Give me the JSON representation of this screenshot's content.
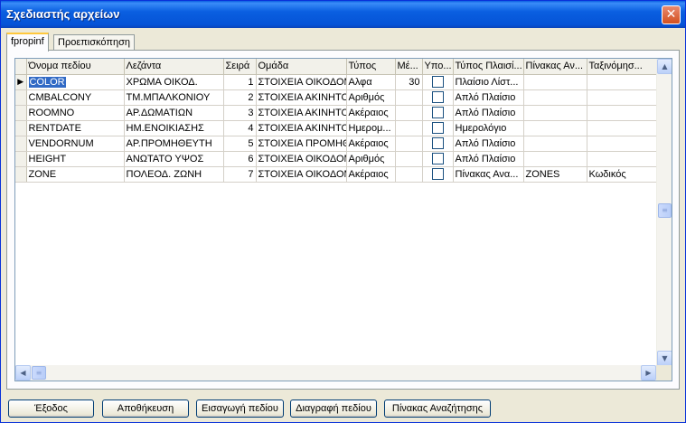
{
  "window": {
    "title": "Σχεδιαστής αρχείων",
    "close_glyph": "✕"
  },
  "tabs": [
    {
      "label": "fpropinf",
      "active": true
    },
    {
      "label": "Προεπισκόπηση",
      "active": false
    }
  ],
  "grid": {
    "columns": [
      "Όνομα πεδίου",
      "Λεζάντα",
      "Σειρά",
      "Ομάδα",
      "Τύπος",
      "Μέ...",
      "Υπο...",
      "Τύπος Πλαισί...",
      "Πίνακας Αν...",
      "Ταξινόμησ..."
    ],
    "rows": [
      {
        "field": "COLOR",
        "caption": "ΧΡΩΜΑ ΟΙΚΟΔ.",
        "order": "1",
        "group": "ΣΤΟΙΧΕΙΑ ΟΙΚΟΔΟΜ.",
        "type": "Αλφα",
        "size": "30",
        "required": false,
        "frame": "Πλαίσιο Λίστ...",
        "lookup": "",
        "sort": "",
        "selected": true
      },
      {
        "field": "CMBALCONY",
        "caption": "ΤΜ.ΜΠΑΛΚΟΝΙΟΥ",
        "order": "2",
        "group": "ΣΤΟΙΧΕΙΑ ΑΚΙΝΗΤΟΥ",
        "type": "Αριθμός",
        "size": "",
        "required": false,
        "frame": "Απλό Πλαίσιο",
        "lookup": "",
        "sort": "",
        "selected": false
      },
      {
        "field": "ROOMNO",
        "caption": "ΑΡ.ΔΩΜΑΤΙΩΝ",
        "order": "3",
        "group": "ΣΤΟΙΧΕΙΑ ΑΚΙΝΗΤΟΥ",
        "type": "Ακέραιος",
        "size": "",
        "required": false,
        "frame": "Απλό Πλαίσιο",
        "lookup": "",
        "sort": "",
        "selected": false
      },
      {
        "field": "RENTDATE",
        "caption": "ΗΜ.ΕΝΟΙΚΙΑΣΗΣ",
        "order": "4",
        "group": "ΣΤΟΙΧΕΙΑ ΑΚΙΝΗΤΟΥ",
        "type": "Ημερομ...",
        "size": "",
        "required": false,
        "frame": "Ημερολόγιο",
        "lookup": "",
        "sort": "",
        "selected": false
      },
      {
        "field": "VENDORNUM",
        "caption": "ΑΡ.ΠΡΟΜΗΘΕΥΤΗ",
        "order": "5",
        "group": "ΣΤΟΙΧΕΙΑ ΠΡΟΜΗΘ.",
        "type": "Ακέραιος",
        "size": "",
        "required": false,
        "frame": "Απλό Πλαίσιο",
        "lookup": "",
        "sort": "",
        "selected": false
      },
      {
        "field": "HEIGHT",
        "caption": "ΑΝΩΤΑΤΟ ΥΨΟΣ",
        "order": "6",
        "group": "ΣΤΟΙΧΕΙΑ ΟΙΚΟΔΟΜ.",
        "type": "Αριθμός",
        "size": "",
        "required": false,
        "frame": "Απλό Πλαίσιο",
        "lookup": "",
        "sort": "",
        "selected": false
      },
      {
        "field": "ZONE",
        "caption": "ΠΟΛΕΟΔ. ΖΩΝΗ",
        "order": "7",
        "group": "ΣΤΟΙΧΕΙΑ ΟΙΚΟΔΟΜ.",
        "type": "Ακέραιος",
        "size": "",
        "required": false,
        "frame": "Πίνακας Ανα...",
        "lookup": "ZONES",
        "sort": "Κωδικός",
        "selected": false
      }
    ],
    "row_pointer_glyph": "▶"
  },
  "scroll": {
    "up": "▲",
    "down": "▼",
    "left": "◀",
    "right": "▶",
    "grip": "≡"
  },
  "buttons": {
    "exit": "Έξοδος",
    "save": "Αποθήκευση",
    "insert_field": "Εισαγωγή πεδίου",
    "delete_field": "Διαγραφή πεδίου",
    "lookup_table": "Πίνακας Αναζήτησης"
  },
  "colors": {
    "titlebar": "#0a5fe0",
    "selection": "#316ac5",
    "tab_highlight": "#ffc83c"
  }
}
